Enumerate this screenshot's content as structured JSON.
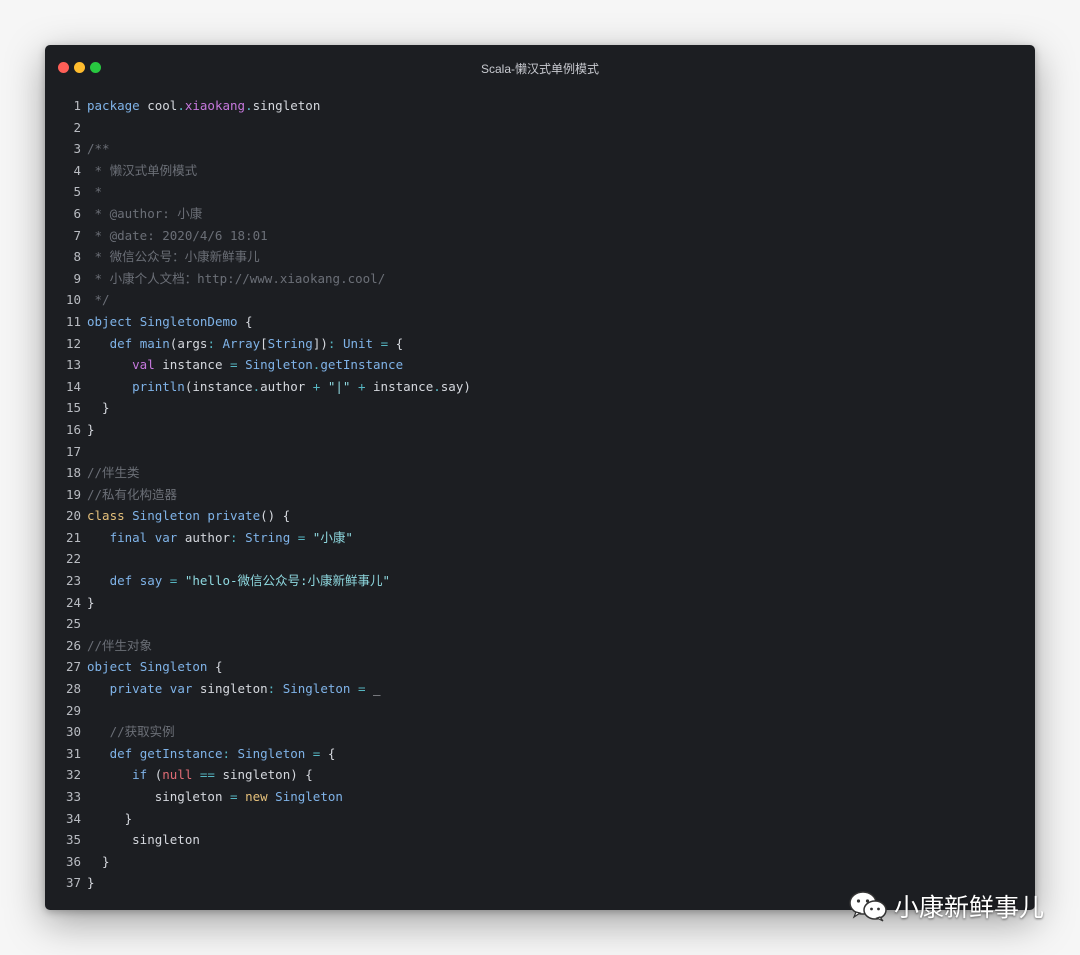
{
  "window": {
    "title": "Scala-懒汉式单例模式",
    "controls": [
      "close-button",
      "minimize-button",
      "zoom-button"
    ]
  },
  "code_lines": [
    {
      "n": "1",
      "tokens": [
        [
          "kw",
          "package "
        ],
        [
          "pl",
          "cool"
        ],
        [
          "op",
          "."
        ],
        [
          "pu",
          "xiaokang"
        ],
        [
          "op",
          "."
        ],
        [
          "pl",
          "singleton"
        ]
      ]
    },
    {
      "n": "2",
      "tokens": []
    },
    {
      "n": "3",
      "tokens": [
        [
          "cm",
          "/**"
        ]
      ]
    },
    {
      "n": "4",
      "tokens": [
        [
          "cm",
          " * 懒汉式单例模式"
        ]
      ]
    },
    {
      "n": "5",
      "tokens": [
        [
          "cm",
          " *"
        ]
      ]
    },
    {
      "n": "6",
      "tokens": [
        [
          "cm",
          " * @author: 小康"
        ]
      ]
    },
    {
      "n": "7",
      "tokens": [
        [
          "cm",
          " * @date: 2020/4/6 18:01"
        ]
      ]
    },
    {
      "n": "8",
      "tokens": [
        [
          "cm",
          " * 微信公众号：小康新鲜事儿"
        ]
      ]
    },
    {
      "n": "9",
      "tokens": [
        [
          "cm",
          " * 小康个人文档：http://www.xiaokang.cool/"
        ]
      ]
    },
    {
      "n": "10",
      "tokens": [
        [
          "cm",
          " */"
        ]
      ]
    },
    {
      "n": "11",
      "tokens": [
        [
          "kw",
          "object "
        ],
        [
          "ty",
          "SingletonDemo"
        ],
        [
          "pl",
          " {"
        ]
      ]
    },
    {
      "n": "12",
      "tokens": [
        [
          "pl",
          "   "
        ],
        [
          "kw",
          "def "
        ],
        [
          "fn",
          "main"
        ],
        [
          "pl",
          "("
        ],
        [
          "pl",
          "args"
        ],
        [
          "op",
          ": "
        ],
        [
          "ty",
          "Array"
        ],
        [
          "pl",
          "["
        ],
        [
          "ty",
          "String"
        ],
        [
          "pl",
          "])"
        ],
        [
          "op",
          ": "
        ],
        [
          "ty",
          "Unit"
        ],
        [
          "op",
          " = "
        ],
        [
          "pl",
          "{"
        ]
      ]
    },
    {
      "n": "13",
      "tokens": [
        [
          "pl",
          "      "
        ],
        [
          "ve",
          "val "
        ],
        [
          "pl",
          "instance "
        ],
        [
          "op",
          "= "
        ],
        [
          "ty",
          "Singleton"
        ],
        [
          "op",
          "."
        ],
        [
          "fn",
          "getInstance"
        ]
      ]
    },
    {
      "n": "14",
      "tokens": [
        [
          "pl",
          "      "
        ],
        [
          "fn",
          "println"
        ],
        [
          "pl",
          "(instance"
        ],
        [
          "op",
          "."
        ],
        [
          "pl",
          "author "
        ],
        [
          "op",
          "+ "
        ],
        [
          "st",
          "\"|\""
        ],
        [
          "op",
          " + "
        ],
        [
          "pl",
          "instance"
        ],
        [
          "op",
          "."
        ],
        [
          "pl",
          "say)"
        ]
      ]
    },
    {
      "n": "15",
      "tokens": [
        [
          "pl",
          "  }"
        ]
      ]
    },
    {
      "n": "16",
      "tokens": [
        [
          "pl",
          "}"
        ]
      ]
    },
    {
      "n": "17",
      "tokens": []
    },
    {
      "n": "18",
      "tokens": [
        [
          "cm",
          "//伴生类"
        ]
      ]
    },
    {
      "n": "19",
      "tokens": [
        [
          "cm",
          "//私有化构造器"
        ]
      ]
    },
    {
      "n": "20",
      "tokens": [
        [
          "kw2",
          "class "
        ],
        [
          "ty",
          "Singleton "
        ],
        [
          "kw",
          "private"
        ],
        [
          "pl",
          "() {"
        ]
      ]
    },
    {
      "n": "21",
      "tokens": [
        [
          "pl",
          "   "
        ],
        [
          "kw",
          "final "
        ],
        [
          "kw",
          "var "
        ],
        [
          "pl",
          "author"
        ],
        [
          "op",
          ": "
        ],
        [
          "ty",
          "String"
        ],
        [
          "op",
          " = "
        ],
        [
          "st",
          "\"小康\""
        ]
      ]
    },
    {
      "n": "22",
      "tokens": []
    },
    {
      "n": "23",
      "tokens": [
        [
          "pl",
          "   "
        ],
        [
          "kw",
          "def "
        ],
        [
          "fn",
          "say"
        ],
        [
          "op",
          " = "
        ],
        [
          "st",
          "\"hello-微信公众号:小康新鲜事儿\""
        ]
      ]
    },
    {
      "n": "24",
      "tokens": [
        [
          "pl",
          "}"
        ]
      ]
    },
    {
      "n": "25",
      "tokens": []
    },
    {
      "n": "26",
      "tokens": [
        [
          "cm",
          "//伴生对象"
        ]
      ]
    },
    {
      "n": "27",
      "tokens": [
        [
          "kw",
          "object "
        ],
        [
          "ty",
          "Singleton"
        ],
        [
          "pl",
          " {"
        ]
      ]
    },
    {
      "n": "28",
      "tokens": [
        [
          "pl",
          "   "
        ],
        [
          "kw",
          "private "
        ],
        [
          "kw",
          "var "
        ],
        [
          "pl",
          "singleton"
        ],
        [
          "op",
          ": "
        ],
        [
          "ty",
          "Singleton"
        ],
        [
          "op",
          " = "
        ],
        [
          "pl",
          "_"
        ]
      ]
    },
    {
      "n": "29",
      "tokens": []
    },
    {
      "n": "30",
      "tokens": [
        [
          "pl",
          "   "
        ],
        [
          "cm",
          "//获取实例"
        ]
      ]
    },
    {
      "n": "31",
      "tokens": [
        [
          "pl",
          "   "
        ],
        [
          "kw",
          "def "
        ],
        [
          "fn",
          "getInstance"
        ],
        [
          "op",
          ": "
        ],
        [
          "ty",
          "Singleton"
        ],
        [
          "op",
          " = "
        ],
        [
          "pl",
          "{"
        ]
      ]
    },
    {
      "n": "32",
      "tokens": [
        [
          "pl",
          "      "
        ],
        [
          "kw",
          "if "
        ],
        [
          "pl",
          "("
        ],
        [
          "lit",
          "null"
        ],
        [
          "op",
          " == "
        ],
        [
          "pl",
          "singleton) {"
        ]
      ]
    },
    {
      "n": "33",
      "tokens": [
        [
          "pl",
          "         "
        ],
        [
          "pl",
          "singleton "
        ],
        [
          "op",
          "= "
        ],
        [
          "kw2",
          "new "
        ],
        [
          "ty",
          "Singleton"
        ]
      ]
    },
    {
      "n": "34",
      "tokens": [
        [
          "pl",
          "     }"
        ]
      ]
    },
    {
      "n": "35",
      "tokens": [
        [
          "pl",
          "      "
        ],
        [
          "pl",
          "singleton"
        ]
      ]
    },
    {
      "n": "36",
      "tokens": [
        [
          "pl",
          "  }"
        ]
      ]
    },
    {
      "n": "37",
      "tokens": [
        [
          "pl",
          "}"
        ]
      ]
    }
  ],
  "watermark": {
    "text": "小康新鲜事儿",
    "icon": "wechat-icon"
  }
}
